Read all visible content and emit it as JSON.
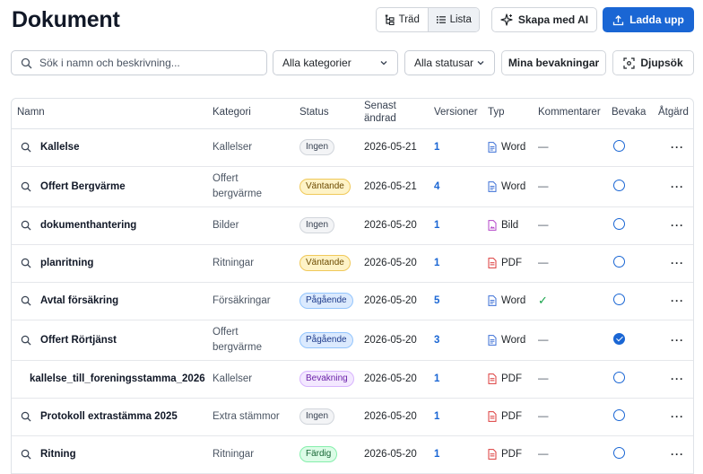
{
  "page": {
    "title": "Dokument"
  },
  "view_toggle": {
    "tree_label": "Träd",
    "list_label": "Lista",
    "active": "list"
  },
  "actions": {
    "ai_label": "Skapa med AI",
    "upload_label": "Ladda upp"
  },
  "filters": {
    "search_placeholder": "Sök i namn och beskrivning...",
    "category_value": "Alla kategorier",
    "status_value": "Alla statusar",
    "watch_label": "Mina bevakningar",
    "deep_label": "Djupsök"
  },
  "table": {
    "headers": {
      "name": "Namn",
      "category": "Kategori",
      "status": "Status",
      "changed": "Senast ändrad",
      "versions": "Versioner",
      "type": "Typ",
      "comments": "Kommentarer",
      "watch": "Bevaka",
      "action": "Åtgärd"
    },
    "rows": [
      {
        "name": "Kallelse",
        "category": "Kallelser",
        "status": "Ingen",
        "status_kind": "none",
        "changed": "2026-05-21",
        "versions": "1",
        "type": "Word",
        "type_kind": "word",
        "comments": "—",
        "watched": false,
        "more": "···"
      },
      {
        "name": "Offert Bergvärme",
        "category": "Offert bergvärme",
        "status": "Väntande",
        "status_kind": "wait",
        "changed": "2026-05-21",
        "versions": "4",
        "type": "Word",
        "type_kind": "word",
        "comments": "—",
        "watched": false,
        "more": "···"
      },
      {
        "name": "dokumenthantering",
        "category": "Bilder",
        "status": "Ingen",
        "status_kind": "none",
        "changed": "2026-05-20",
        "versions": "1",
        "type": "Bild",
        "type_kind": "image",
        "comments": "—",
        "watched": false,
        "more": "···"
      },
      {
        "name": "planritning",
        "category": "Ritningar",
        "status": "Väntande",
        "status_kind": "wait",
        "changed": "2026-05-20",
        "versions": "1",
        "type": "PDF",
        "type_kind": "pdf",
        "comments": "—",
        "watched": false,
        "more": "···"
      },
      {
        "name": "Avtal försäkring",
        "category": "Försäkringar",
        "status": "Pågående",
        "status_kind": "going",
        "changed": "2026-05-20",
        "versions": "5",
        "type": "Word",
        "type_kind": "word",
        "comments": "✓",
        "watched": false,
        "more": "···"
      },
      {
        "name": "Offert Rörtjänst",
        "category": "Offert bergvärme",
        "status": "Pågående",
        "status_kind": "going",
        "changed": "2026-05-20",
        "versions": "3",
        "type": "Word",
        "type_kind": "word",
        "comments": "—",
        "watched": true,
        "more": "···"
      },
      {
        "name": "kallelse_till_foreningsstamma_2026",
        "category": "Kallelser",
        "status": "Bevakning",
        "status_kind": "watch",
        "changed": "2026-05-20",
        "versions": "1",
        "type": "PDF",
        "type_kind": "pdf",
        "comments": "—",
        "watched": false,
        "more": "···"
      },
      {
        "name": "Protokoll extrastämma 2025",
        "category": "Extra stämmor",
        "status": "Ingen",
        "status_kind": "none",
        "changed": "2026-05-20",
        "versions": "1",
        "type": "PDF",
        "type_kind": "pdf",
        "comments": "—",
        "watched": false,
        "more": "···"
      },
      {
        "name": "Ritning",
        "category": "Ritningar",
        "status": "Färdig",
        "status_kind": "done",
        "changed": "2026-05-20",
        "versions": "1",
        "type": "PDF",
        "type_kind": "pdf",
        "comments": "—",
        "watched": false,
        "more": "···"
      }
    ]
  },
  "colors": {
    "accent": "#1a66d4",
    "word": "#3b6fd6",
    "pdf": "#dc3b3b",
    "image": "#b344c8"
  }
}
